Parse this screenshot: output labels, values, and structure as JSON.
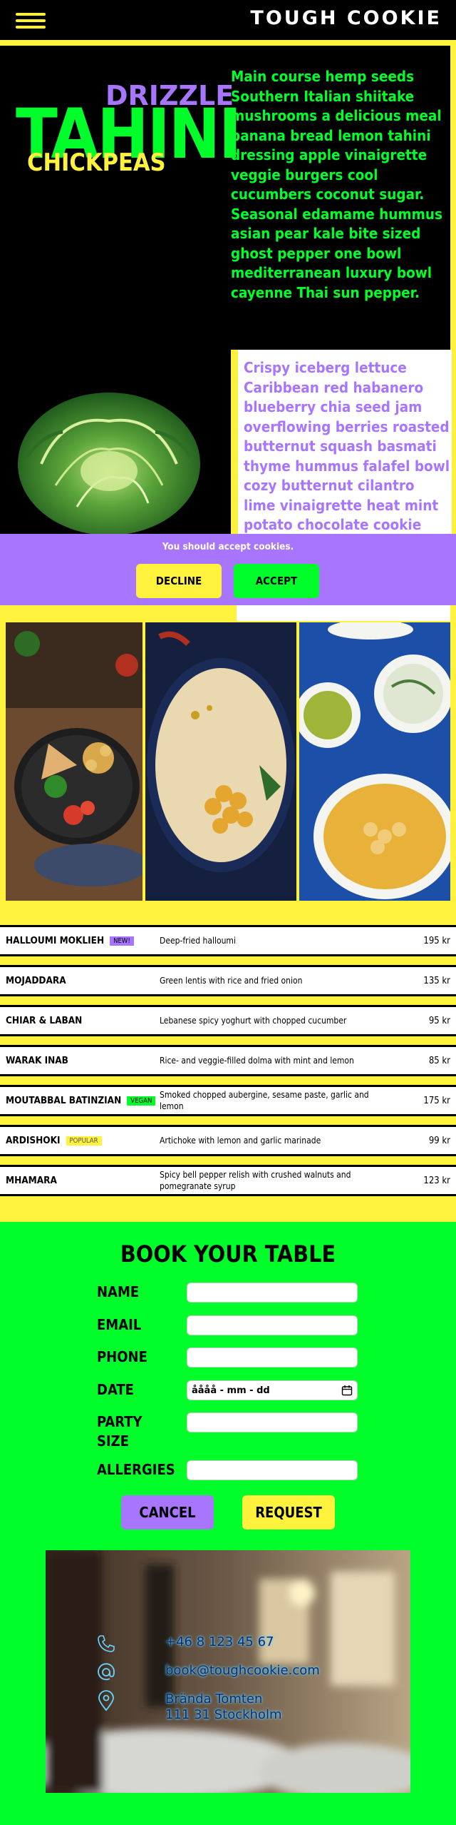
{
  "header": {
    "brand": "TOUGH COOKIE",
    "menu_icon": "hamburger-icon"
  },
  "hero": {
    "drizzle": "DRIZZLE",
    "tahini": "TAHINI",
    "chickpeas": "CHICKPEAS",
    "paragraph": "Main course hemp seeds Southern Italian shiitake mushrooms a delicious meal banana bread lemon tahini dressing apple vinaigrette veggie burgers cool cucumbers coconut sugar. Seasonal edamame hummus asian pear kale bite sized ghost pepper one bowl mediterranean luxury bowl cayenne Thai sun pepper.",
    "purple_paragraph": "Crispy iceberg lettuce Caribbean red habanero blueberry chia seed jam overflowing berries roasted butternut squash basmati thyme hummus falafel bowl cozy butternut cilantro lime vinaigrette heat mint potato chocolate cookie seeds samosa walnut mushroom tart."
  },
  "cookie_banner": {
    "text": "You should accept cookies.",
    "decline": "DECLINE",
    "accept": "ACCEPT"
  },
  "menu": {
    "items": [
      {
        "name": "HALLOUMI MOKLIEH",
        "tag": "NEW!",
        "tag_type": "new",
        "desc": "Deep-fried halloumi",
        "price": "195 kr"
      },
      {
        "name": "MOJADDARA",
        "tag": "",
        "tag_type": "",
        "desc": "Green lentis with rice and fried onion",
        "price": "135 kr"
      },
      {
        "name": "CHIAR & LABAN",
        "tag": "",
        "tag_type": "",
        "desc": "Lebanese spicy yoghurt with chopped cucumber",
        "price": "95 kr"
      },
      {
        "name": "WARAK INAB",
        "tag": "",
        "tag_type": "",
        "desc": "Rice- and veggie-filled dolma with mint and lemon",
        "price": "85 kr"
      },
      {
        "name": "MOUTABBAL BATINZIAN",
        "tag": "VEGAN",
        "tag_type": "vegan",
        "desc": "Smoked chopped aubergine, sesame paste, garlic and lemon",
        "price": "175 kr"
      },
      {
        "name": "ARDISHOKI",
        "tag": "POPULAR",
        "tag_type": "popular",
        "desc": "Artichoke with lemon and garlic marinade",
        "price": "99 kr"
      },
      {
        "name": "MHAMARA",
        "tag": "",
        "tag_type": "",
        "desc": "Spicy bell pepper relish with crushed walnuts and pomegranate syrup",
        "price": "123 kr"
      }
    ]
  },
  "booking": {
    "title": "BOOK YOUR TABLE",
    "labels": {
      "name": "NAME",
      "email": "EMAIL",
      "phone": "PHONE",
      "date": "DATE",
      "party": "PARTY SIZE",
      "allergies": "ALLERGIES"
    },
    "date_placeholder": "åååå - mm - dd",
    "cancel": "CANCEL",
    "request": "REQUEST"
  },
  "contact": {
    "phone": "+46 8 123 45 67",
    "email": "book@toughcookie.com",
    "address_line1": "Brända Tomten",
    "address_line2": "111 31 Stockholm"
  },
  "colors": {
    "yellow": "#fff23d",
    "green": "#00ff2a",
    "purple": "#a875ff",
    "black": "#000000"
  }
}
